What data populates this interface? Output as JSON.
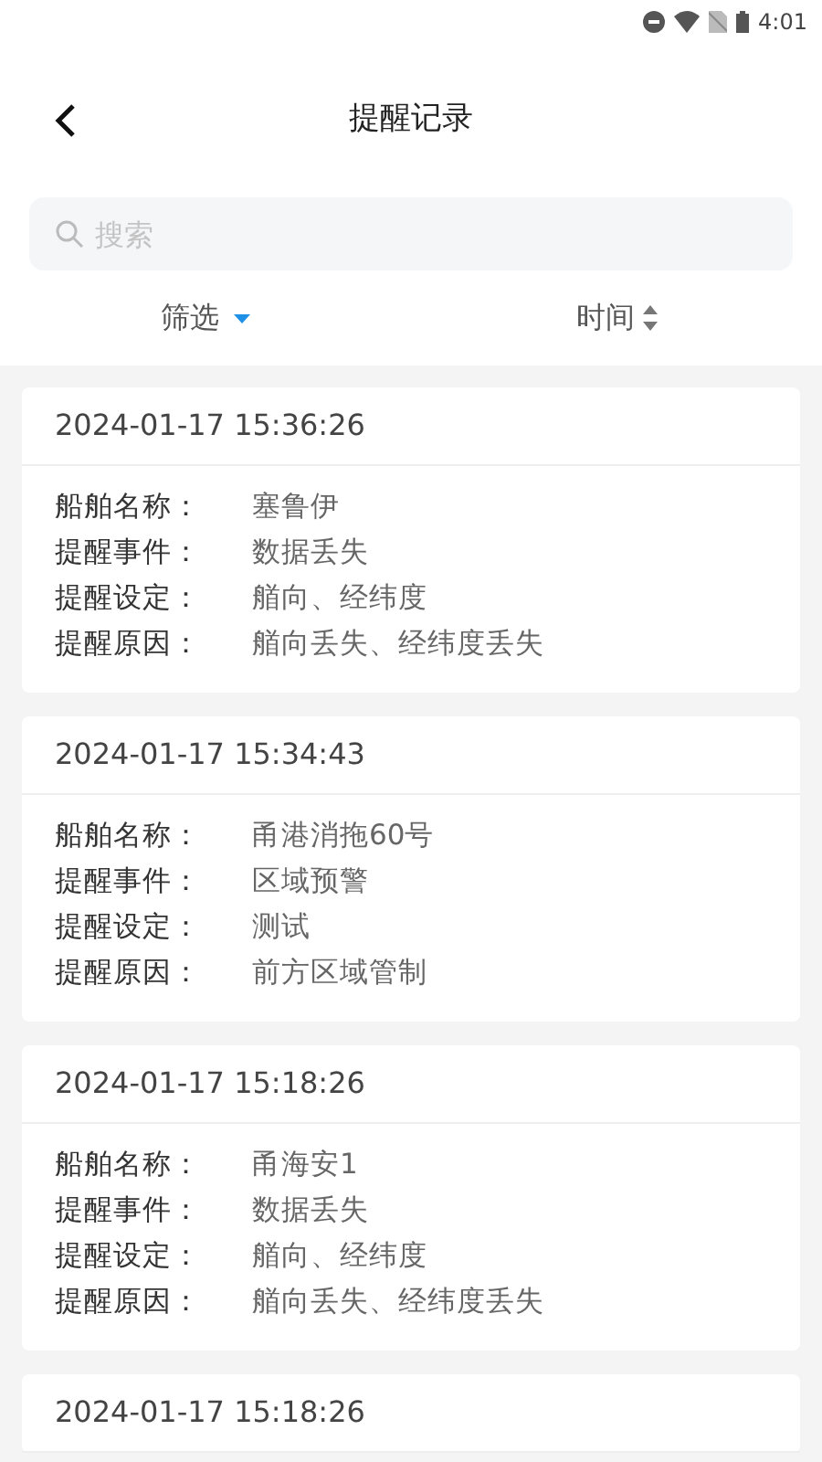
{
  "status_bar": {
    "time": "4:01"
  },
  "header": {
    "title": "提醒记录"
  },
  "search": {
    "placeholder": "搜索"
  },
  "toolbar": {
    "filter": "筛选",
    "sort": "时间"
  },
  "records": [
    {
      "time": "2024-01-17 15:36:26",
      "fields": [
        {
          "label": "船舶名称：",
          "value": "塞鲁伊"
        },
        {
          "label": "提醒事件：",
          "value": "数据丢失"
        },
        {
          "label": "提醒设定：",
          "value": "艏向、经纬度"
        },
        {
          "label": "提醒原因：",
          "value": "艏向丢失、经纬度丢失"
        }
      ]
    },
    {
      "time": "2024-01-17 15:34:43",
      "fields": [
        {
          "label": "船舶名称：",
          "value": "甬港消拖60号"
        },
        {
          "label": "提醒事件：",
          "value": "区域预警"
        },
        {
          "label": "提醒设定：",
          "value": "测试"
        },
        {
          "label": "提醒原因：",
          "value": "前方区域管制"
        }
      ]
    },
    {
      "time": "2024-01-17 15:18:26",
      "fields": [
        {
          "label": "船舶名称：",
          "value": "甬海安1"
        },
        {
          "label": "提醒事件：",
          "value": "数据丢失"
        },
        {
          "label": "提醒设定：",
          "value": "艏向、经纬度"
        },
        {
          "label": "提醒原因：",
          "value": "艏向丢失、经纬度丢失"
        }
      ]
    },
    {
      "time": "2024-01-17 15:18:26"
    }
  ]
}
